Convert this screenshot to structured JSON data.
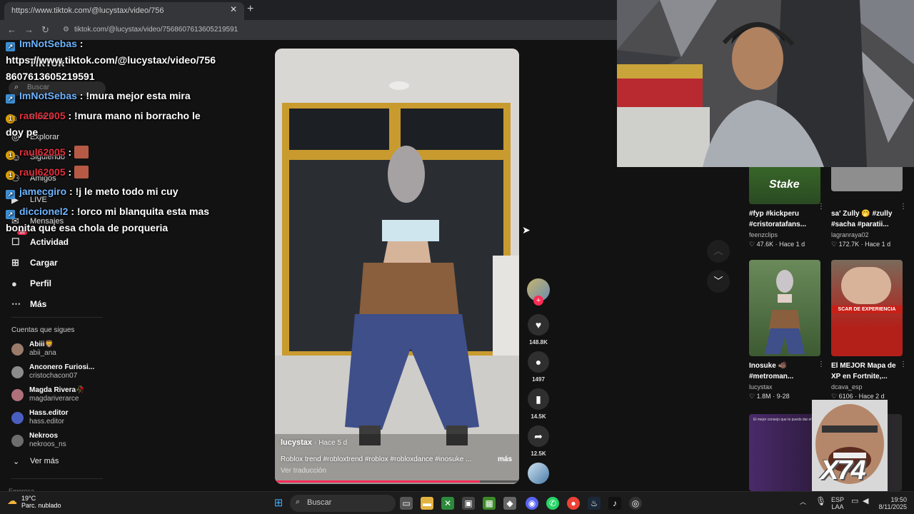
{
  "browser": {
    "tab_title": "https://www.tiktok.com/@lucystax/video/756",
    "url": "tiktok.com/@lucystax/video/7568607613605219591"
  },
  "sidebar": {
    "logo": "TikTok",
    "search_placeholder": "Buscar",
    "items": [
      {
        "label": "Para ti",
        "icon": "home-icon"
      },
      {
        "label": "Explorar",
        "icon": "compass-icon"
      },
      {
        "label": "Siguiendo",
        "icon": "following-icon"
      },
      {
        "label": "Amigos",
        "icon": "friends-icon"
      },
      {
        "label": "LIVE",
        "icon": "live-icon"
      },
      {
        "label": "Mensajes",
        "icon": "messages-icon"
      },
      {
        "label": "Actividad",
        "icon": "activity-icon",
        "badge": "16"
      },
      {
        "label": "Cargar",
        "icon": "upload-icon"
      },
      {
        "label": "Perfil",
        "icon": "profile-icon"
      },
      {
        "label": "Más",
        "icon": "more-icon"
      }
    ],
    "following_title": "Cuentas que sigues",
    "following": [
      {
        "name": "Abiii🦁",
        "handle": "abii_ana",
        "color": "#9a7b6a"
      },
      {
        "name": "Anconero Furiosi...",
        "handle": "cristochacon07",
        "color": "#8c8c8c"
      },
      {
        "name": "Magda Rivera🥀",
        "handle": "magdariverarce",
        "color": "#b0707a"
      },
      {
        "name": "Hass.editor",
        "handle": "hass.editor",
        "color": "#4a5ec0"
      },
      {
        "name": "Nekroos",
        "handle": "nekroos_ns",
        "color": "#6d6d6d"
      }
    ],
    "see_more": "Ver más",
    "footer": "Empresa"
  },
  "chat": [
    {
      "user": "ImNotSebas",
      "text": " :",
      "badge": "blue",
      "color": "blue"
    },
    {
      "user": "",
      "text": "https://www.tiktok.com/@lucystax/video/756",
      "badge": "",
      "color": ""
    },
    {
      "user": "",
      "text": "8607613605219591",
      "badge": "",
      "color": ""
    },
    {
      "user": "ImNotSebas",
      "text": " : !mura mejor esta mira",
      "badge": "blue",
      "color": "blue"
    },
    {
      "user": "raul62005",
      "text": " : !mura mano ni borracho le",
      "badge": "orange",
      "color": "red"
    },
    {
      "user": "",
      "text": "doy pe",
      "badge": "",
      "color": ""
    },
    {
      "user": "raul62005",
      "text": " : ",
      "badge": "orange",
      "color": "red",
      "emote": true
    },
    {
      "user": "raul62005",
      "text": " : ",
      "badge": "orange",
      "color": "red",
      "emote": true
    },
    {
      "user": "jamecgiro",
      "text": " : !j le meto todo mi cuy",
      "badge": "blue",
      "color": "blue"
    },
    {
      "user": "diccionel2",
      "text": " : !orco mi blanquita esta mas",
      "badge": "blue",
      "color": "blue"
    },
    {
      "user": "",
      "text": "bonita que esa chola de porqueria",
      "badge": "",
      "color": ""
    }
  ],
  "video": {
    "author": "lucystax",
    "time": "· Hace 5 d",
    "caption": "Roblox trend #robloxtrend #roblox #robloxdance #inosuke ...",
    "more": "más",
    "translate": "Ver traducción",
    "progress": 0.84
  },
  "actions": {
    "likes": "148.8K",
    "comments": "1497",
    "saves": "14.5K",
    "shares": "12.5K"
  },
  "related": [
    {
      "title": "#fyp #kickperu #cristoratafans...",
      "author": "feenzclips",
      "likes": "47.6K",
      "age": "Hace 1 d",
      "thumb_text": "Stake"
    },
    {
      "title": "sa' Zully 🤭 #zully #sacha #paratii...",
      "author": "lagranraya02",
      "likes": "172.7K",
      "age": "Hace 1 d",
      "thumb_text": ""
    },
    {
      "title": "Inosuke 🐗 #metroman...",
      "author": "lucystax",
      "likes": "1.8M",
      "age": "9-28",
      "thumb_text": ""
    },
    {
      "title": "El MEJOR Mapa de XP en Fortnite,...",
      "author": "dcava_esp",
      "likes": "6106",
      "age": "Hace 2 d",
      "thumb_text": "SCAR DE EXPERIENCIA"
    },
    {
      "title": "",
      "author": "",
      "likes": "",
      "age": "",
      "thumb_text": "El mejor consejo que te puedo dar el día de"
    }
  ],
  "overlay": {
    "meme_text": "X74"
  },
  "taskbar": {
    "temp": "19°C",
    "weather": "Parc. nublado",
    "search": "Buscar",
    "lang_top": "ESP",
    "lang_bottom": "LAA",
    "time": "19:50",
    "date": "8/11/2025"
  }
}
